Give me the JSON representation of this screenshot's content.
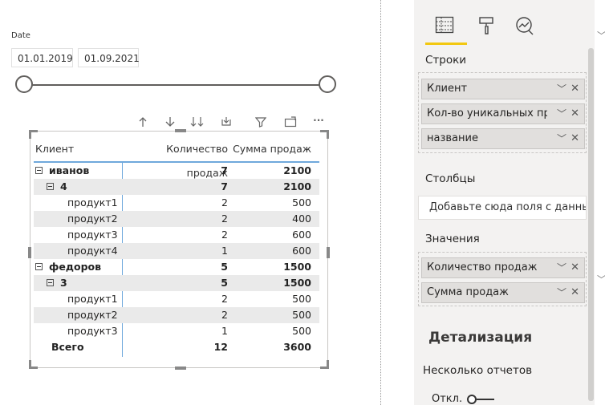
{
  "slicer": {
    "title": "Date",
    "start_date": "01.01.2019",
    "end_date": "01.09.2021"
  },
  "matrix": {
    "headers": {
      "client": "Клиент",
      "qty": "Количество продаж",
      "sum": "Сумма продаж"
    },
    "rows": [
      {
        "label": "иванов",
        "qty": "7",
        "sum": "2100"
      },
      {
        "label": "4",
        "qty": "7",
        "sum": "2100"
      },
      {
        "label": "продукт1",
        "qty": "2",
        "sum": "500"
      },
      {
        "label": "продукт2",
        "qty": "2",
        "sum": "400"
      },
      {
        "label": "продукт3",
        "qty": "2",
        "sum": "600"
      },
      {
        "label": "продукт4",
        "qty": "1",
        "sum": "600"
      },
      {
        "label": "федоров",
        "qty": "5",
        "sum": "1500"
      },
      {
        "label": "3",
        "qty": "5",
        "sum": "1500"
      },
      {
        "label": "продукт1",
        "qty": "2",
        "sum": "500"
      },
      {
        "label": "продукт2",
        "qty": "2",
        "sum": "500"
      },
      {
        "label": "продукт3",
        "qty": "1",
        "sum": "500"
      },
      {
        "label": "Всего",
        "qty": "12",
        "sum": "3600"
      }
    ]
  },
  "visual_header": {
    "icons": [
      "drill-up-icon",
      "drill-down-icon",
      "expand-all-icon",
      "expand-hierarchy-icon",
      "filter-icon",
      "focus-mode-icon",
      "more-options-icon"
    ],
    "more_glyph": "···"
  },
  "panel": {
    "rows_label": "Строки",
    "rows_fields": [
      "Клиент",
      "Кол-во уникальных продаж",
      "название"
    ],
    "columns_label": "Столбцы",
    "columns_placeholder": "Добавьте сюда поля с данными",
    "values_label": "Значения",
    "values_fields": [
      "Количество продаж",
      "Сумма продаж"
    ],
    "drill_title": "Детализация",
    "multi_reports_label": "Несколько отчетов",
    "toggle_label": "Откл.",
    "toggle_on": false,
    "accent_color": "#f2c811"
  }
}
